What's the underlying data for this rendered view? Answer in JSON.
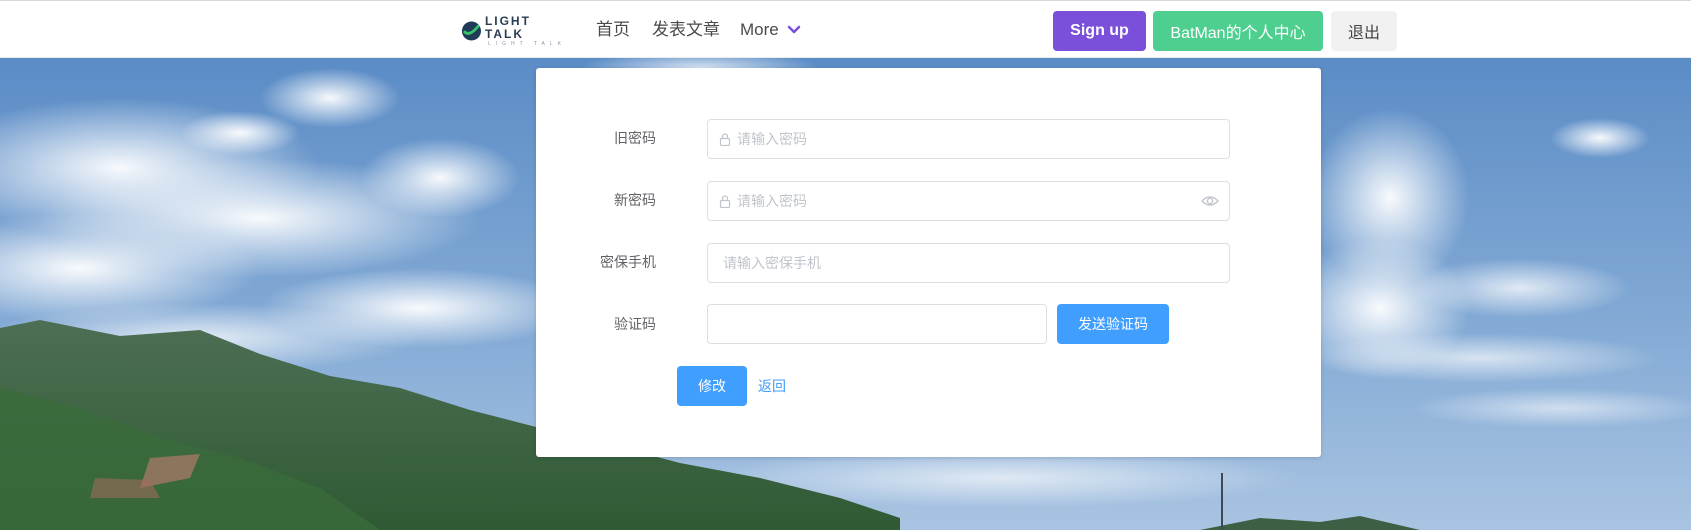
{
  "nav": {
    "logo_text": "LIGHT TALK",
    "logo_subtext": "LIGHT TALK",
    "home": "首页",
    "post": "发表文章",
    "more": "More",
    "signup": "Sign up",
    "user_center": "BatMan的个人中心",
    "logout": "退出"
  },
  "form": {
    "old_password": {
      "label": "旧密码",
      "placeholder": "请输入密码",
      "value": ""
    },
    "new_password": {
      "label": "新密码",
      "placeholder": "请输入密码",
      "value": ""
    },
    "phone": {
      "label": "密保手机",
      "placeholder": "请输入密保手机",
      "value": ""
    },
    "code": {
      "label": "验证码",
      "placeholder": "",
      "value": ""
    },
    "send_code": "发送验证码",
    "submit": "修改",
    "back": "返回"
  },
  "colors": {
    "signup_bg": "#7a4fd9",
    "user_center_bg": "#4fcf8f",
    "primary": "#409eff"
  },
  "icons": [
    "logo-icon",
    "chevron-down-icon",
    "lock-icon",
    "eye-icon"
  ]
}
